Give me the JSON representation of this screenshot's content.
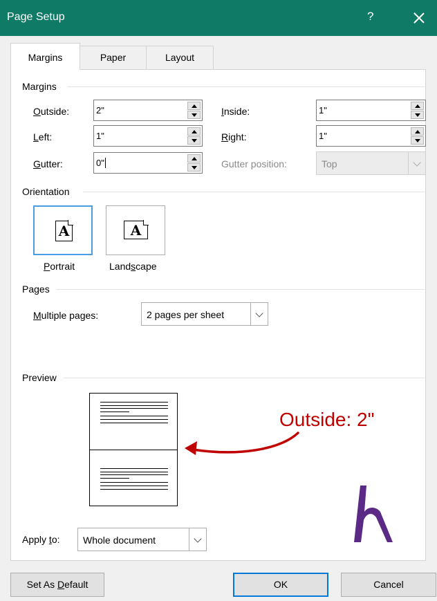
{
  "window": {
    "title": "Page Setup",
    "help": "?"
  },
  "tabs": [
    {
      "label": "Margins",
      "active": true
    },
    {
      "label": "Paper",
      "active": false
    },
    {
      "label": "Layout",
      "active": false
    }
  ],
  "margins": {
    "group_label": "Margins",
    "outside": {
      "label_u": "O",
      "label_rest": "utside:",
      "value": "2\""
    },
    "inside": {
      "label_u": "I",
      "label_rest": "nside:",
      "value": "1\""
    },
    "left": {
      "label_u": "L",
      "label_rest": "eft:",
      "value": "1\""
    },
    "right": {
      "label_u": "R",
      "label_rest": "ight:",
      "value": "1\""
    },
    "gutter": {
      "label_u": "G",
      "label_rest": "utter:",
      "value": "0\""
    },
    "gutter_position": {
      "label": "Gutter position:",
      "value": "Top"
    }
  },
  "orientation": {
    "group_label": "Orientation",
    "glyph": "A",
    "portrait": {
      "label_u": "P",
      "label_rest": "ortrait",
      "selected": true
    },
    "landscape": {
      "label_pre": "Land",
      "label_u": "s",
      "label_rest": "cape",
      "selected": false
    }
  },
  "pages": {
    "group_label": "Pages",
    "multiple_label_u": "M",
    "multiple_label_rest": "ultiple pages:",
    "multiple_value": "2 pages per sheet"
  },
  "preview": {
    "group_label": "Preview"
  },
  "apply_to": {
    "label_pre": "Apply ",
    "label_u": "t",
    "label_rest": "o:",
    "value": "Whole document"
  },
  "buttons": {
    "set_default_pre": "Set As ",
    "set_default_u": "D",
    "set_default_rest": "efault",
    "ok": "OK",
    "cancel": "Cancel"
  },
  "annotation": {
    "text": "Outside: 2\"",
    "color": "#c00000"
  },
  "colors": {
    "titlebar": "#0f7b67",
    "accent": "#0078d7",
    "logo": "#5b2a86"
  },
  "icons": {
    "help": "help-icon",
    "close": "close-icon",
    "logo": "logo-icon"
  }
}
